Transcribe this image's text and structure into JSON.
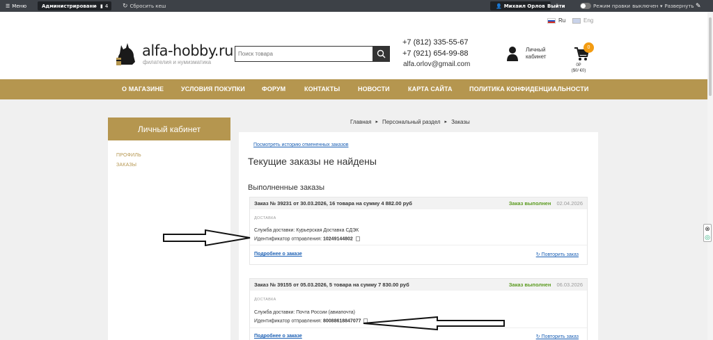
{
  "adminbar": {
    "menu": "Меню",
    "admin": "Администрирование",
    "count": "4",
    "cache": "Сбросить кеш",
    "user": "Михаил Орлов",
    "exit": "Выйти",
    "mode": "Режим правки",
    "mode_state": "выключен",
    "expand": "Развернуть"
  },
  "header": {
    "lang_ru": "Ru",
    "lang_en": "Eng",
    "logo_title": "alfa-hobby.ru",
    "logo_sub": "филателия и нумизматика",
    "search_placeholder": "Поиск товара",
    "phone1": "+7 (812) 335-55-67",
    "phone2": "+7 (921) 654-99-88",
    "email": "alfa.orlov@gmail.com",
    "cabinet_line1": "Личный",
    "cabinet_line2": "кабинет",
    "cart_count": "0",
    "cart_line1": "0Р",
    "cart_line2": "($0/ €0)"
  },
  "nav": [
    "О МАГАЗИНЕ",
    "УСЛОВИЯ ПОКУПКИ",
    "ФОРУМ",
    "КОНТАКТЫ",
    "НОВОСТИ",
    "КАРТА САЙТА",
    "ПОЛИТИКА КОНФИДЕНЦИАЛЬНОСТИ"
  ],
  "sidebar": {
    "title": "Личный кабинет",
    "items": [
      "ПРОФИЛЬ",
      "ЗАКАЗЫ"
    ]
  },
  "breadcrumbs": [
    "Главная",
    "Персональный раздел",
    "Заказы"
  ],
  "main": {
    "history_link": "Посмотреть историю отмененных заказов",
    "no_current": "Текущие заказы не найдены",
    "done_title": "Выполненные заказы"
  },
  "orders": [
    {
      "title": "Заказ № 39231 от 30.03.2026, 16 товара на сумму 4 882.00 руб",
      "status": "Заказ выполнен",
      "date": "02.04.2026",
      "section": "ДОСТАВКА",
      "service_label": "Служба доставки:",
      "service": "Курьерская Доставка СДЭК",
      "tracking_label": "Идентификатор отправления:",
      "tracking": "10249144802",
      "more": "Подробнее о заказе",
      "repeat": "Повторить заказ"
    },
    {
      "title": "Заказ № 39155 от 05.03.2026, 5 товара на сумму 7 830.00 руб",
      "status": "Заказ выполнен",
      "date": "06.03.2026",
      "section": "ДОСТАВКА",
      "service_label": "Служба доставки:",
      "service": "Почта России (авиапочта)",
      "tracking_label": "Идентификатор отправления:",
      "tracking": "80088618847077",
      "more": "Подробнее о заказе",
      "repeat": "Повторить заказ"
    }
  ],
  "colors": {
    "brand": "#b5964f",
    "status_green": "#5a9a1e",
    "link_blue": "#1a5fb4",
    "cart_badge": "#f39c12"
  }
}
